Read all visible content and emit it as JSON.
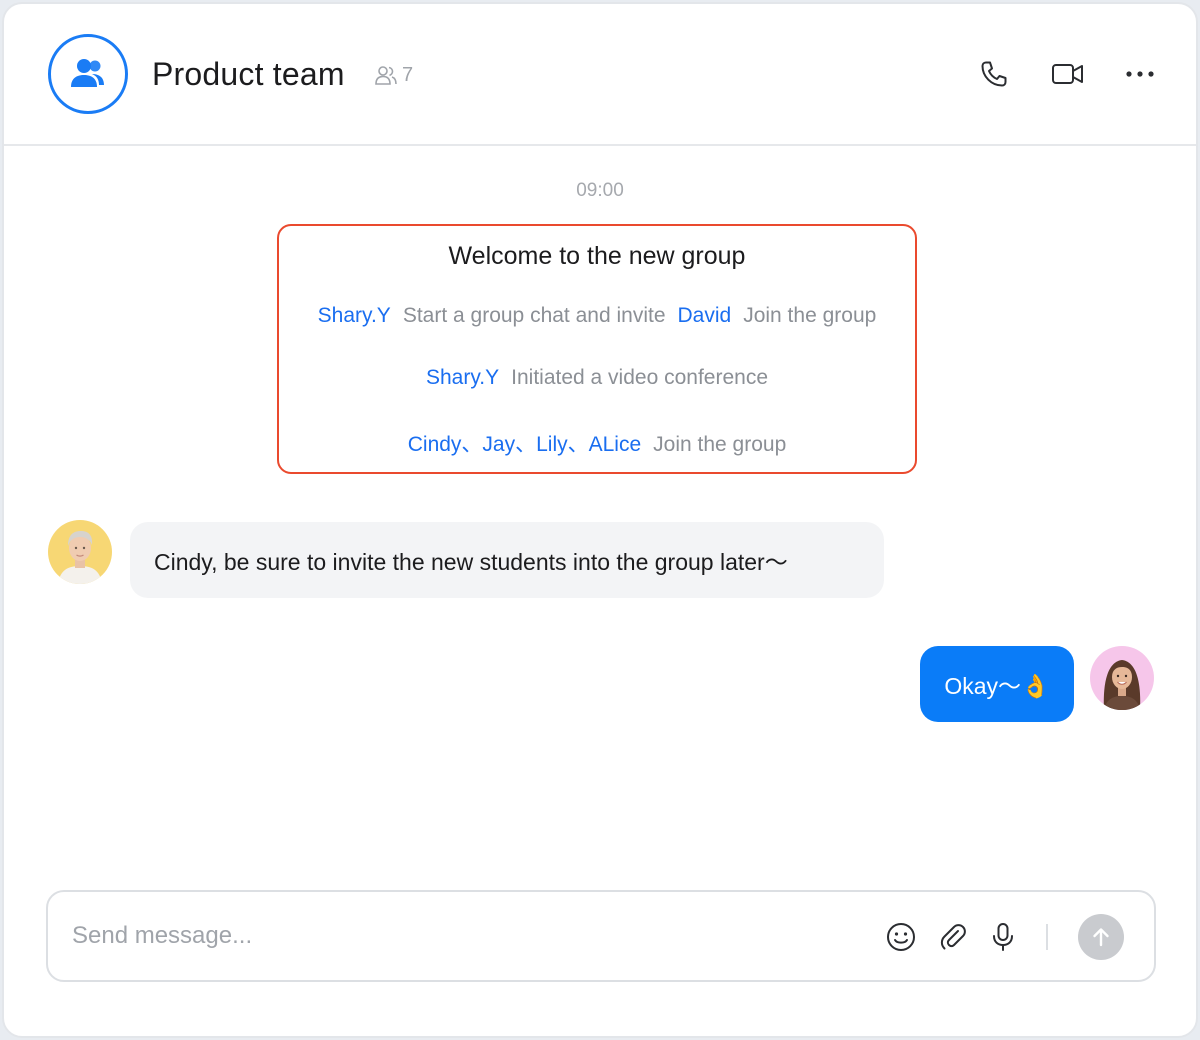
{
  "header": {
    "title": "Product team",
    "member_count": "7",
    "actions": [
      "phone-icon",
      "video-icon",
      "more-icon"
    ]
  },
  "messages": {
    "timestamp": "09:00",
    "notice": {
      "title": "Welcome to the new group",
      "line1": {
        "name1": "Shary.Y",
        "text1": "Start a group chat and invite",
        "name2": "David",
        "text2": "Join the group"
      },
      "line2": {
        "name1": "Shary.Y",
        "text1": "Initiated a video conference"
      },
      "line3": {
        "names": "Cindy、Jay、Lily、ALice",
        "text1": "Join the group"
      }
    },
    "incoming": {
      "text": "Cindy, be sure to invite the new students into the group later～"
    },
    "outgoing": {
      "text": "Okay～👌"
    }
  },
  "composer": {
    "placeholder": "Send message...",
    "icons": [
      "emoji-icon",
      "attachment-icon",
      "microphone-icon",
      "send-icon"
    ]
  },
  "colors": {
    "accent": "#1a7cf5",
    "outgoing_bubble": "#0a7cf8",
    "incoming_bubble": "#f3f4f6",
    "notice_border": "#ea4a2e",
    "name_link": "#1a6ef0"
  }
}
